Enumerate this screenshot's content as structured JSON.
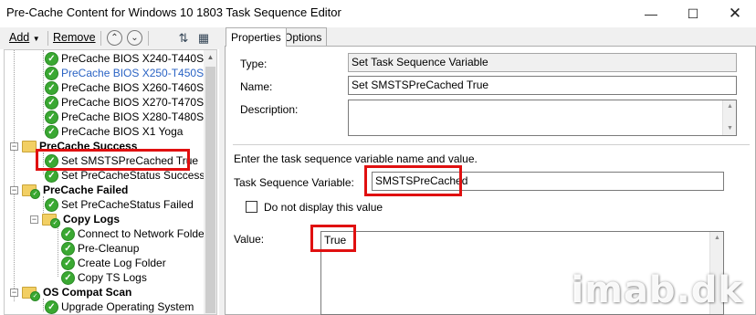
{
  "window": {
    "title": "Pre-Cache Content for Windows 10 1803 Task Sequence Editor",
    "minimize_icon": "minimize-icon",
    "maximize_icon": "maximize-icon",
    "close_icon": "close-icon"
  },
  "toolbar": {
    "add_label": "Add",
    "remove_label": "Remove"
  },
  "tree": {
    "items": [
      {
        "label": "PreCache BIOS X240-T440S",
        "type": "step"
      },
      {
        "label": "PreCache BIOS X250-T450S",
        "type": "step",
        "color": "#2a63c4"
      },
      {
        "label": "PreCache BIOS X260-T460S",
        "type": "step"
      },
      {
        "label": "PreCache BIOS X270-T470S",
        "type": "step"
      },
      {
        "label": "PreCache BIOS X280-T480S",
        "type": "step"
      },
      {
        "label": "PreCache BIOS X1 Yoga",
        "type": "step"
      },
      {
        "label": "PreCache Success",
        "type": "group"
      },
      {
        "label": "Set SMSTSPreCached True",
        "type": "step",
        "selected": true
      },
      {
        "label": "Set PreCacheStatus Success",
        "type": "step"
      },
      {
        "label": "PreCache Failed",
        "type": "group"
      },
      {
        "label": "Set PreCacheStatus Failed",
        "type": "step"
      },
      {
        "label": "Copy Logs",
        "type": "group"
      },
      {
        "label": "Connect to Network Folder",
        "type": "step"
      },
      {
        "label": "Pre-Cleanup",
        "type": "step"
      },
      {
        "label": "Create Log Folder",
        "type": "step"
      },
      {
        "label": "Copy TS Logs",
        "type": "step"
      },
      {
        "label": "OS Compat Scan",
        "type": "group"
      },
      {
        "label": "Upgrade Operating System",
        "type": "step"
      }
    ]
  },
  "tabs": [
    {
      "label": "Properties",
      "active": true
    },
    {
      "label": "Options",
      "active": false
    }
  ],
  "properties": {
    "type_label": "Type:",
    "type_value": "Set Task Sequence Variable",
    "name_label": "Name:",
    "name_value": "Set SMSTSPreCached True",
    "description_label": "Description:",
    "description_value": "",
    "instruction": "Enter the task sequence variable name and value.",
    "variable_label": "Task Sequence Variable:",
    "variable_value": "SMSTSPreCached",
    "hide_checkbox_label": "Do not display this value",
    "value_label": "Value:",
    "value_value": "True"
  },
  "colors": {
    "highlight": "#e01010",
    "success_green": "#3aa832",
    "folder_yellow": "#f2cf63"
  },
  "watermark": "imab.dk"
}
